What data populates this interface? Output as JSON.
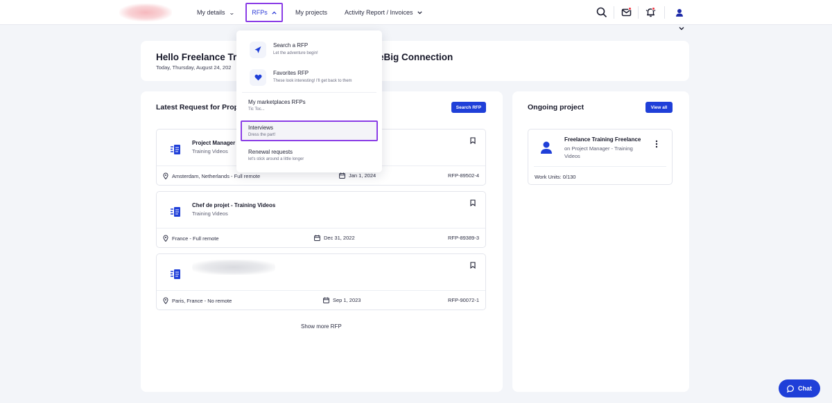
{
  "nav": {
    "my_details": "My details",
    "rfps": "RFPs",
    "my_projects": "My projects",
    "activity_report": "Activity Report / Invoices"
  },
  "greeting": {
    "title_start": "Hello Freelance Tra",
    "title_end": "eBig Connection",
    "date": "Today, Thursday, August 24, 202"
  },
  "latest": {
    "title": "Latest Request for Prop",
    "search_button": "Search RFP",
    "show_more": "Show more RFP",
    "items": [
      {
        "title": "Project Manager",
        "subtitle": "Training Videos",
        "location": "Amsterdam, Netherlands - Full remote",
        "date": "Jan 1, 2024",
        "id": "RFP-89502-4"
      },
      {
        "title": "Chef de projet - Training Videos",
        "subtitle": "Training Videos",
        "location": "France - Full remote",
        "date": "Dec 31, 2022",
        "id": "RFP-89389-3"
      },
      {
        "title": "",
        "subtitle": "",
        "location": "Paris, France - No remote",
        "date": "Sep 1, 2023",
        "id": "RFP-90072-1"
      }
    ]
  },
  "ongoing": {
    "title": "Ongoing project",
    "view_all": "View all",
    "project_title": "Freelance Training Freelance",
    "project_subtitle": "on Project Manager - Training Videos",
    "work_units": "Work Units: 0/130"
  },
  "dropdown": {
    "items": [
      {
        "label": "Search a RFP",
        "desc": "Let the adventure begin!"
      },
      {
        "label": "Favorites RFP",
        "desc": "These look interesting! I'll get back to them"
      },
      {
        "label": "My marketplaces RFPs",
        "desc": "Tic Toc..."
      },
      {
        "label": "Interviews",
        "desc": "Dress the part!"
      },
      {
        "label": "Renewal requests",
        "desc": "let's stick around a little longer"
      }
    ]
  },
  "chat": {
    "label": "Chat"
  },
  "colors": {
    "primary": "#1f3fd8",
    "highlight": "#8a3ce6",
    "badge": "#f0313f"
  }
}
